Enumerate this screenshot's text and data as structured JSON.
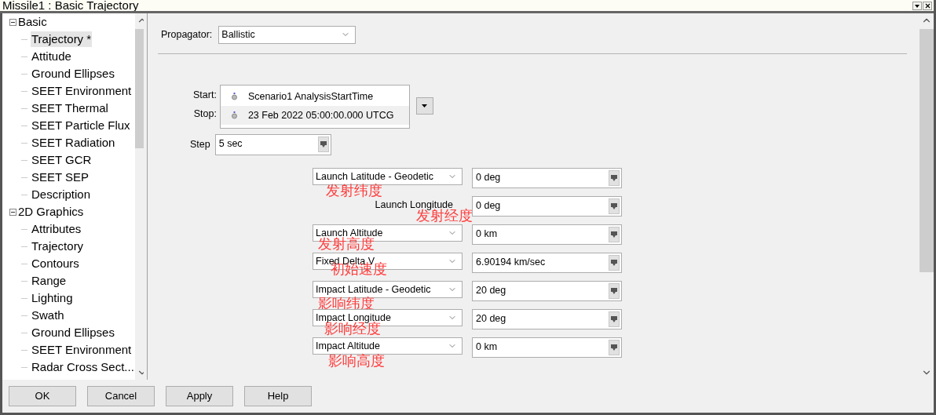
{
  "window": {
    "title": "Missile1 : Basic Trajectory"
  },
  "tree": [
    {
      "label": "Basic",
      "expanded": true,
      "children": [
        {
          "label": "Trajectory *",
          "selected": true
        },
        {
          "label": "Attitude",
          "selected": false
        },
        {
          "label": "Ground Ellipses",
          "selected": false
        },
        {
          "label": "SEET Environment",
          "selected": false
        },
        {
          "label": "SEET Thermal",
          "selected": false
        },
        {
          "label": "SEET Particle Flux",
          "selected": false
        },
        {
          "label": "SEET Radiation",
          "selected": false
        },
        {
          "label": "SEET GCR",
          "selected": false
        },
        {
          "label": "SEET SEP",
          "selected": false
        },
        {
          "label": "Description",
          "selected": false
        }
      ]
    },
    {
      "label": "2D Graphics",
      "expanded": true,
      "children": [
        {
          "label": "Attributes",
          "selected": false
        },
        {
          "label": "Trajectory",
          "selected": false
        },
        {
          "label": "Contours",
          "selected": false
        },
        {
          "label": "Range",
          "selected": false
        },
        {
          "label": "Lighting",
          "selected": false
        },
        {
          "label": "Swath",
          "selected": false
        },
        {
          "label": "Ground Ellipses",
          "selected": false
        },
        {
          "label": "SEET Environment",
          "selected": false
        },
        {
          "label": "Radar Cross Sect...",
          "selected": false
        }
      ]
    }
  ],
  "propagator": {
    "label": "Propagator:",
    "value": "Ballistic"
  },
  "interval": {
    "start_label": "Start:",
    "start_value": "Scenario1 AnalysisStartTime",
    "stop_label": "Stop:",
    "stop_value": "23 Feb 2022 05:00:00.000 UTCG"
  },
  "step": {
    "label": "Step",
    "value": "5 sec"
  },
  "parameters": [
    {
      "kind": "dropdown",
      "label": "Launch Latitude - Geodetic",
      "value": "0 deg",
      "annotation": "发射纬度"
    },
    {
      "kind": "label",
      "label": "Launch Longitude",
      "value": "0 deg",
      "annotation": "发射经度"
    },
    {
      "kind": "dropdown",
      "label": "Launch Altitude",
      "value": "0 km",
      "annotation": "发射高度"
    },
    {
      "kind": "dropdown",
      "label": "Fixed Delta V",
      "value": "6.90194 km/sec",
      "annotation": "初始速度"
    },
    {
      "kind": "dropdown",
      "label": "Impact Latitude - Geodetic",
      "value": "20 deg",
      "annotation": "影响纬度"
    },
    {
      "kind": "dropdown",
      "label": "Impact Longitude",
      "value": "20 deg",
      "annotation": "影响经度"
    },
    {
      "kind": "dropdown",
      "label": "Impact Altitude",
      "value": "0 km",
      "annotation": "影响高度"
    }
  ],
  "buttons": [
    "OK",
    "Cancel",
    "Apply",
    "Help"
  ]
}
